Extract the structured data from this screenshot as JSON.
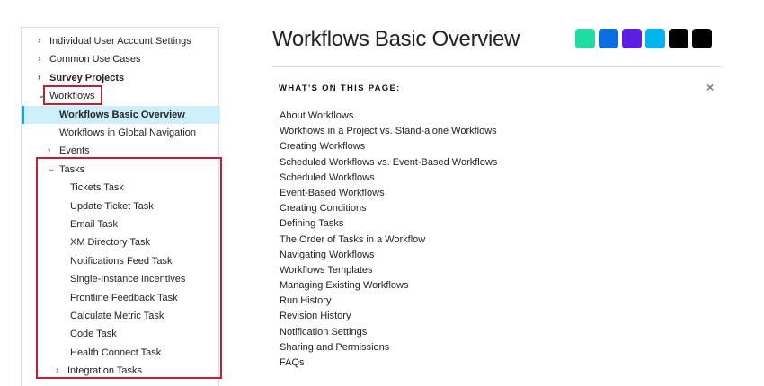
{
  "sidebar": {
    "items": [
      {
        "label": "Individual User Account Settings",
        "chev": "›"
      },
      {
        "label": "Common Use Cases",
        "chev": "›"
      },
      {
        "label": "Survey Projects",
        "chev": "›"
      },
      {
        "label": "Workflows",
        "chev": "⌄"
      },
      {
        "label": "Workflows Basic Overview"
      },
      {
        "label": "Workflows in Global Navigation"
      },
      {
        "label": "Events",
        "chev": "›"
      },
      {
        "label": "Tasks",
        "chev": "⌄"
      },
      {
        "label": "Tickets Task"
      },
      {
        "label": "Update Ticket Task"
      },
      {
        "label": "Email Task"
      },
      {
        "label": "XM Directory Task"
      },
      {
        "label": "Notifications Feed Task"
      },
      {
        "label": "Single-Instance Incentives"
      },
      {
        "label": "Frontline Feedback Task"
      },
      {
        "label": "Calculate Metric Task"
      },
      {
        "label": "Code Task"
      },
      {
        "label": "Health Connect Task"
      },
      {
        "label": "Integration Tasks",
        "chev": "›"
      }
    ]
  },
  "main": {
    "title": "Workflows Basic Overview",
    "logo_colors": [
      "#21dba5",
      "#0b6ee0",
      "#5a1fe0",
      "#00b4ef",
      "#000000",
      "#000000"
    ],
    "toc_heading": "WHAT'S ON THIS PAGE:",
    "close_icon": "×",
    "toc": [
      "About Workflows",
      "Workflows in a Project vs. Stand-alone Workflows",
      "Creating Workflows",
      "Scheduled Workflows vs. Event-Based Workflows",
      "Scheduled Workflows",
      "Event-Based Workflows",
      "Creating Conditions",
      "Defining Tasks",
      "The Order of Tasks in a Workflow",
      "Navigating Workflows",
      "Workflows Templates",
      "Managing Existing Workflows",
      "Run History",
      "Revision History",
      "Notification Settings",
      "Sharing and Permissions",
      "FAQs"
    ]
  }
}
